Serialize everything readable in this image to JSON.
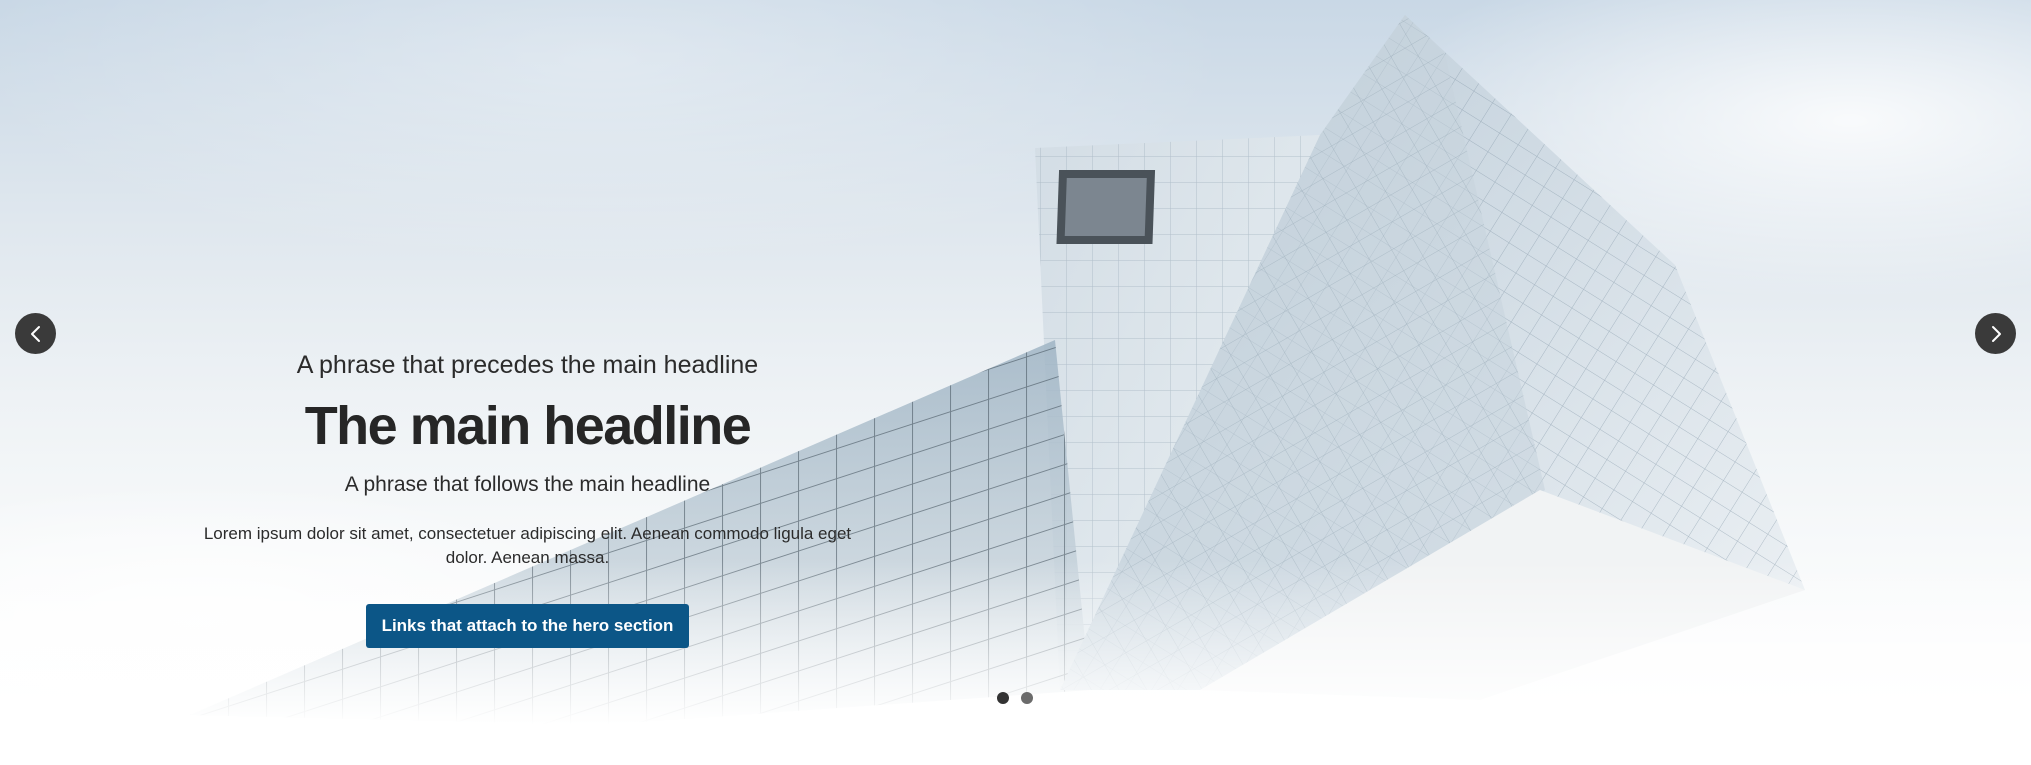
{
  "hero": {
    "pre_headline": "A phrase that precedes the main headline",
    "headline": "The main headline",
    "post_headline": "A phrase that follows the main headline",
    "body": "Lorem ipsum dolor sit amet, consectetuer adipiscing elit. Aenean commodo ligula eget dolor. Aenean massa.",
    "cta_label": "Links that attach to the hero section"
  },
  "carousel": {
    "prev_icon": "chevron-left-icon",
    "next_icon": "chevron-right-icon",
    "slide_count": 2,
    "active_slide": 1
  },
  "colors": {
    "cta_background": "#0c5687",
    "arrow_background": "#3a3a3a",
    "dot_active": "#333333",
    "dot_inactive": "#6b6b6b"
  }
}
